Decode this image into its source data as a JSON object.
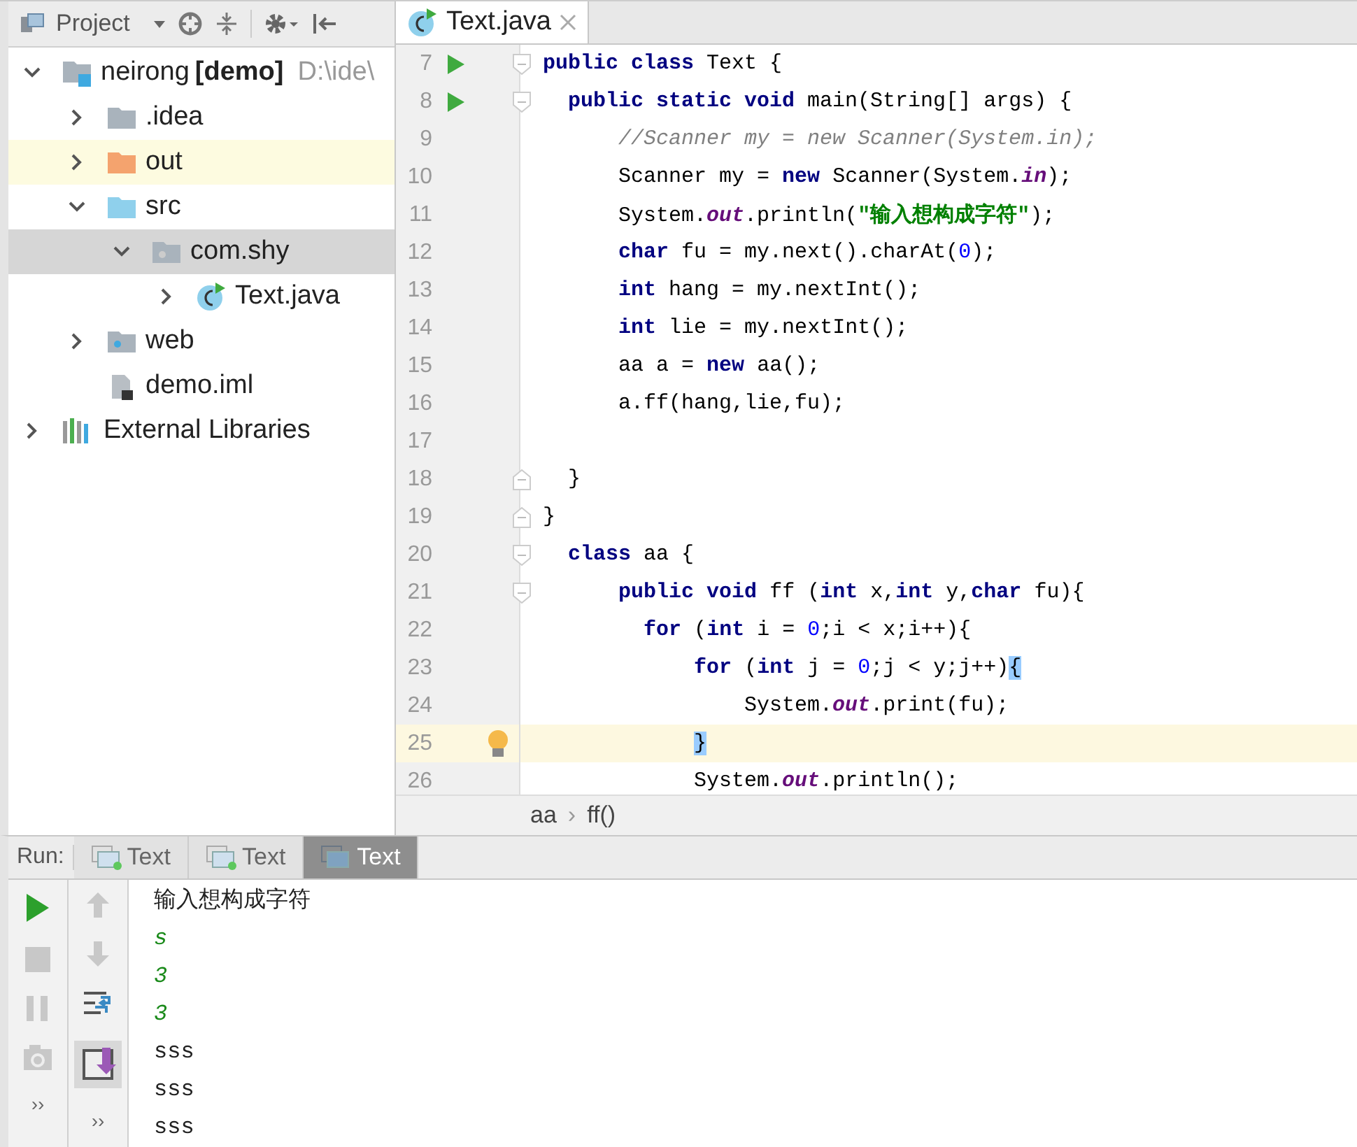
{
  "project_panel": {
    "title": "Project"
  },
  "tree": [
    {
      "label": "neirong",
      "badge": "[demo]",
      "path": "D:\\ide\\",
      "kind": "module",
      "expanded": true,
      "selected": false,
      "hover": false,
      "children": [
        {
          "label": ".idea",
          "kind": "folder",
          "expanded": false,
          "selected": false,
          "hover": false
        },
        {
          "label": "out",
          "kind": "folder-excluded",
          "expanded": false,
          "selected": false,
          "hover": true
        },
        {
          "label": "src",
          "kind": "folder-source",
          "expanded": true,
          "selected": false,
          "hover": false,
          "children": [
            {
              "label": "com.shy",
              "kind": "package",
              "expanded": true,
              "selected": true,
              "hover": false,
              "children": [
                {
                  "label": "Text.java",
                  "kind": "class",
                  "expanded": false,
                  "selected": false,
                  "hover": false
                }
              ]
            }
          ]
        },
        {
          "label": "web",
          "kind": "folder-web",
          "expanded": false,
          "selected": false,
          "hover": false
        },
        {
          "label": "demo.iml",
          "kind": "file",
          "selected": false,
          "hover": false
        }
      ]
    },
    {
      "label": "External Libraries",
      "kind": "library",
      "expanded": false,
      "selected": false,
      "hover": false
    }
  ],
  "editor_tabs": [
    {
      "label": "Text.java",
      "selected": true
    }
  ],
  "code_lines": [
    {
      "num": "7",
      "run": true,
      "fold_start": true,
      "fold_end": false,
      "current": false,
      "bulb": false,
      "tokens": [
        {
          "kind": "keyword",
          "text": "public class "
        },
        {
          "kind": "plain",
          "text": "Text {"
        }
      ]
    },
    {
      "num": "8",
      "run": true,
      "fold_start": true,
      "fold_end": false,
      "current": false,
      "bulb": false,
      "tokens": [
        {
          "kind": "keyword",
          "text": "  public static void "
        },
        {
          "kind": "plain",
          "text": "main(String[] args) {"
        }
      ]
    },
    {
      "num": "9",
      "run": false,
      "fold_start": false,
      "fold_end": false,
      "current": false,
      "bulb": false,
      "tokens": [
        {
          "kind": "comment",
          "text": "      //Scanner my = new Scanner(System.in);"
        }
      ]
    },
    {
      "num": "10",
      "run": false,
      "fold_start": false,
      "fold_end": false,
      "current": false,
      "bulb": false,
      "tokens": [
        {
          "kind": "plain",
          "text": "      Scanner my = "
        },
        {
          "kind": "keyword",
          "text": "new"
        },
        {
          "kind": "plain",
          "text": " Scanner(System."
        },
        {
          "kind": "field",
          "text": "in"
        },
        {
          "kind": "plain",
          "text": ");"
        }
      ]
    },
    {
      "num": "11",
      "run": false,
      "fold_start": false,
      "fold_end": false,
      "current": false,
      "bulb": false,
      "tokens": [
        {
          "kind": "plain",
          "text": "      System."
        },
        {
          "kind": "field",
          "text": "out"
        },
        {
          "kind": "plain",
          "text": ".println("
        },
        {
          "kind": "string",
          "text": "\"输入想构成字符\""
        },
        {
          "kind": "plain",
          "text": ");"
        }
      ]
    },
    {
      "num": "12",
      "run": false,
      "fold_start": false,
      "fold_end": false,
      "current": false,
      "bulb": false,
      "tokens": [
        {
          "kind": "keyword",
          "text": "      char"
        },
        {
          "kind": "plain",
          "text": " fu = my.next().charAt("
        },
        {
          "kind": "number",
          "text": "0"
        },
        {
          "kind": "plain",
          "text": ");"
        }
      ]
    },
    {
      "num": "13",
      "run": false,
      "fold_start": false,
      "fold_end": false,
      "current": false,
      "bulb": false,
      "tokens": [
        {
          "kind": "keyword",
          "text": "      int"
        },
        {
          "kind": "plain",
          "text": " hang = my.nextInt();"
        }
      ]
    },
    {
      "num": "14",
      "run": false,
      "fold_start": false,
      "fold_end": false,
      "current": false,
      "bulb": false,
      "tokens": [
        {
          "kind": "keyword",
          "text": "      int"
        },
        {
          "kind": "plain",
          "text": " lie = my.nextInt();"
        }
      ]
    },
    {
      "num": "15",
      "run": false,
      "fold_start": false,
      "fold_end": false,
      "current": false,
      "bulb": false,
      "tokens": [
        {
          "kind": "plain",
          "text": "      aa a = "
        },
        {
          "kind": "keyword",
          "text": "new"
        },
        {
          "kind": "plain",
          "text": " aa();"
        }
      ]
    },
    {
      "num": "16",
      "run": false,
      "fold_start": false,
      "fold_end": false,
      "current": false,
      "bulb": false,
      "tokens": [
        {
          "kind": "plain",
          "text": "      a.ff(hang,lie,fu);"
        }
      ]
    },
    {
      "num": "17",
      "run": false,
      "fold_start": false,
      "fold_end": false,
      "current": false,
      "bulb": false
    },
    {
      "num": "18",
      "run": false,
      "fold_start": false,
      "fold_end": true,
      "current": false,
      "bulb": false,
      "tokens": [
        {
          "kind": "plain",
          "text": "  }"
        }
      ]
    },
    {
      "num": "19",
      "run": false,
      "fold_start": false,
      "fold_end": true,
      "current": false,
      "bulb": false,
      "tokens": [
        {
          "kind": "plain",
          "text": "}"
        }
      ]
    },
    {
      "num": "20",
      "run": false,
      "fold_start": true,
      "fold_end": false,
      "current": false,
      "bulb": false,
      "tokens": [
        {
          "kind": "keyword",
          "text": "  class"
        },
        {
          "kind": "plain",
          "text": " aa {"
        }
      ]
    },
    {
      "num": "21",
      "run": false,
      "fold_start": true,
      "fold_end": false,
      "current": false,
      "bulb": false,
      "tokens": [
        {
          "kind": "keyword",
          "text": "      public void"
        },
        {
          "kind": "plain",
          "text": " ff ("
        },
        {
          "kind": "keyword",
          "text": "int"
        },
        {
          "kind": "plain",
          "text": " x,"
        },
        {
          "kind": "keyword",
          "text": "int"
        },
        {
          "kind": "plain",
          "text": " y,"
        },
        {
          "kind": "keyword",
          "text": "char"
        },
        {
          "kind": "plain",
          "text": " fu){"
        }
      ]
    },
    {
      "num": "22",
      "run": false,
      "fold_start": false,
      "fold_end": false,
      "current": false,
      "bulb": false,
      "tokens": [
        {
          "kind": "keyword",
          "text": "        for"
        },
        {
          "kind": "plain",
          "text": " ("
        },
        {
          "kind": "keyword",
          "text": "int"
        },
        {
          "kind": "plain",
          "text": " i = "
        },
        {
          "kind": "number",
          "text": "0"
        },
        {
          "kind": "plain",
          "text": ";i < x;i++){"
        }
      ]
    },
    {
      "num": "23",
      "run": false,
      "fold_start": false,
      "fold_end": false,
      "current": false,
      "bulb": false,
      "tokens": [
        {
          "kind": "keyword",
          "text": "            for"
        },
        {
          "kind": "plain",
          "text": " ("
        },
        {
          "kind": "keyword",
          "text": "int"
        },
        {
          "kind": "plain",
          "text": " j = "
        },
        {
          "kind": "number",
          "text": "0"
        },
        {
          "kind": "plain",
          "text": ";j < y;j++)"
        },
        {
          "kind": "brace_match",
          "text": "{"
        }
      ]
    },
    {
      "num": "24",
      "run": false,
      "fold_start": false,
      "fold_end": false,
      "current": false,
      "bulb": false,
      "tokens": [
        {
          "kind": "plain",
          "text": "                System."
        },
        {
          "kind": "field",
          "text": "out"
        },
        {
          "kind": "plain",
          "text": ".print(fu);"
        }
      ]
    },
    {
      "num": "25",
      "run": false,
      "fold_start": false,
      "fold_end": false,
      "current": true,
      "bulb": true,
      "tokens": [
        {
          "kind": "brace_match",
          "text": "            }"
        }
      ]
    },
    {
      "num": "26",
      "run": false,
      "fold_start": false,
      "fold_end": false,
      "current": false,
      "bulb": false,
      "tokens": [
        {
          "kind": "plain",
          "text": "            System."
        },
        {
          "kind": "field",
          "text": "out"
        },
        {
          "kind": "plain",
          "text": ".println();"
        }
      ]
    }
  ],
  "breadcrumbs": [
    "aa",
    "ff()"
  ],
  "breadcrumb_separator": "›",
  "run_panel": {
    "label": "Run:",
    "tabs": [
      {
        "label": "Text",
        "selected": false,
        "running": true
      },
      {
        "label": "Text",
        "selected": false,
        "running": true
      },
      {
        "label": "Text",
        "selected": true,
        "running": false
      }
    ],
    "console": [
      {
        "kind": "output",
        "text": "输入想构成字符"
      },
      {
        "kind": "input",
        "text": "s"
      },
      {
        "kind": "input",
        "text": "3"
      },
      {
        "kind": "input",
        "text": "3"
      },
      {
        "kind": "output",
        "text": "sss"
      },
      {
        "kind": "output",
        "text": "sss"
      },
      {
        "kind": "output",
        "text": "sss"
      }
    ],
    "more_left": "››",
    "more_right": "››"
  }
}
